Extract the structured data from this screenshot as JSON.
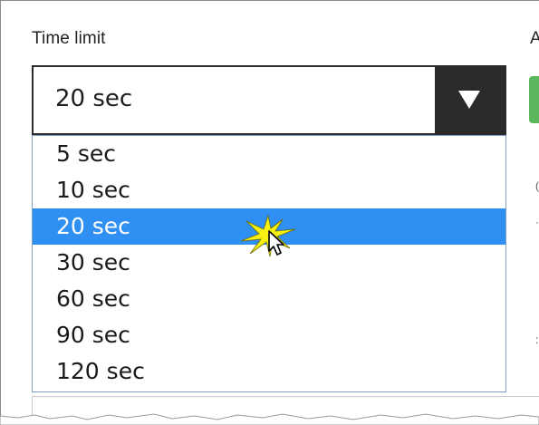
{
  "time_limit": {
    "label": "Time limit",
    "selected_value": "20 sec",
    "options": [
      "5 sec",
      "10 sec",
      "20 sec",
      "30 sec",
      "60 sec",
      "90 sec",
      "120 sec"
    ],
    "highlighted_option": "20 sec"
  },
  "adjacent_field": {
    "label_fragment": "A"
  },
  "icons": {
    "dropdown_arrow": "triangle-down-icon",
    "click_indicator": "click-starburst-icon",
    "pointer": "mouse-pointer-icon"
  },
  "colors": {
    "highlight": "#2f8ff2",
    "arrow_button": "#2a2a2a",
    "adjacent_button": "#5cb85c"
  }
}
